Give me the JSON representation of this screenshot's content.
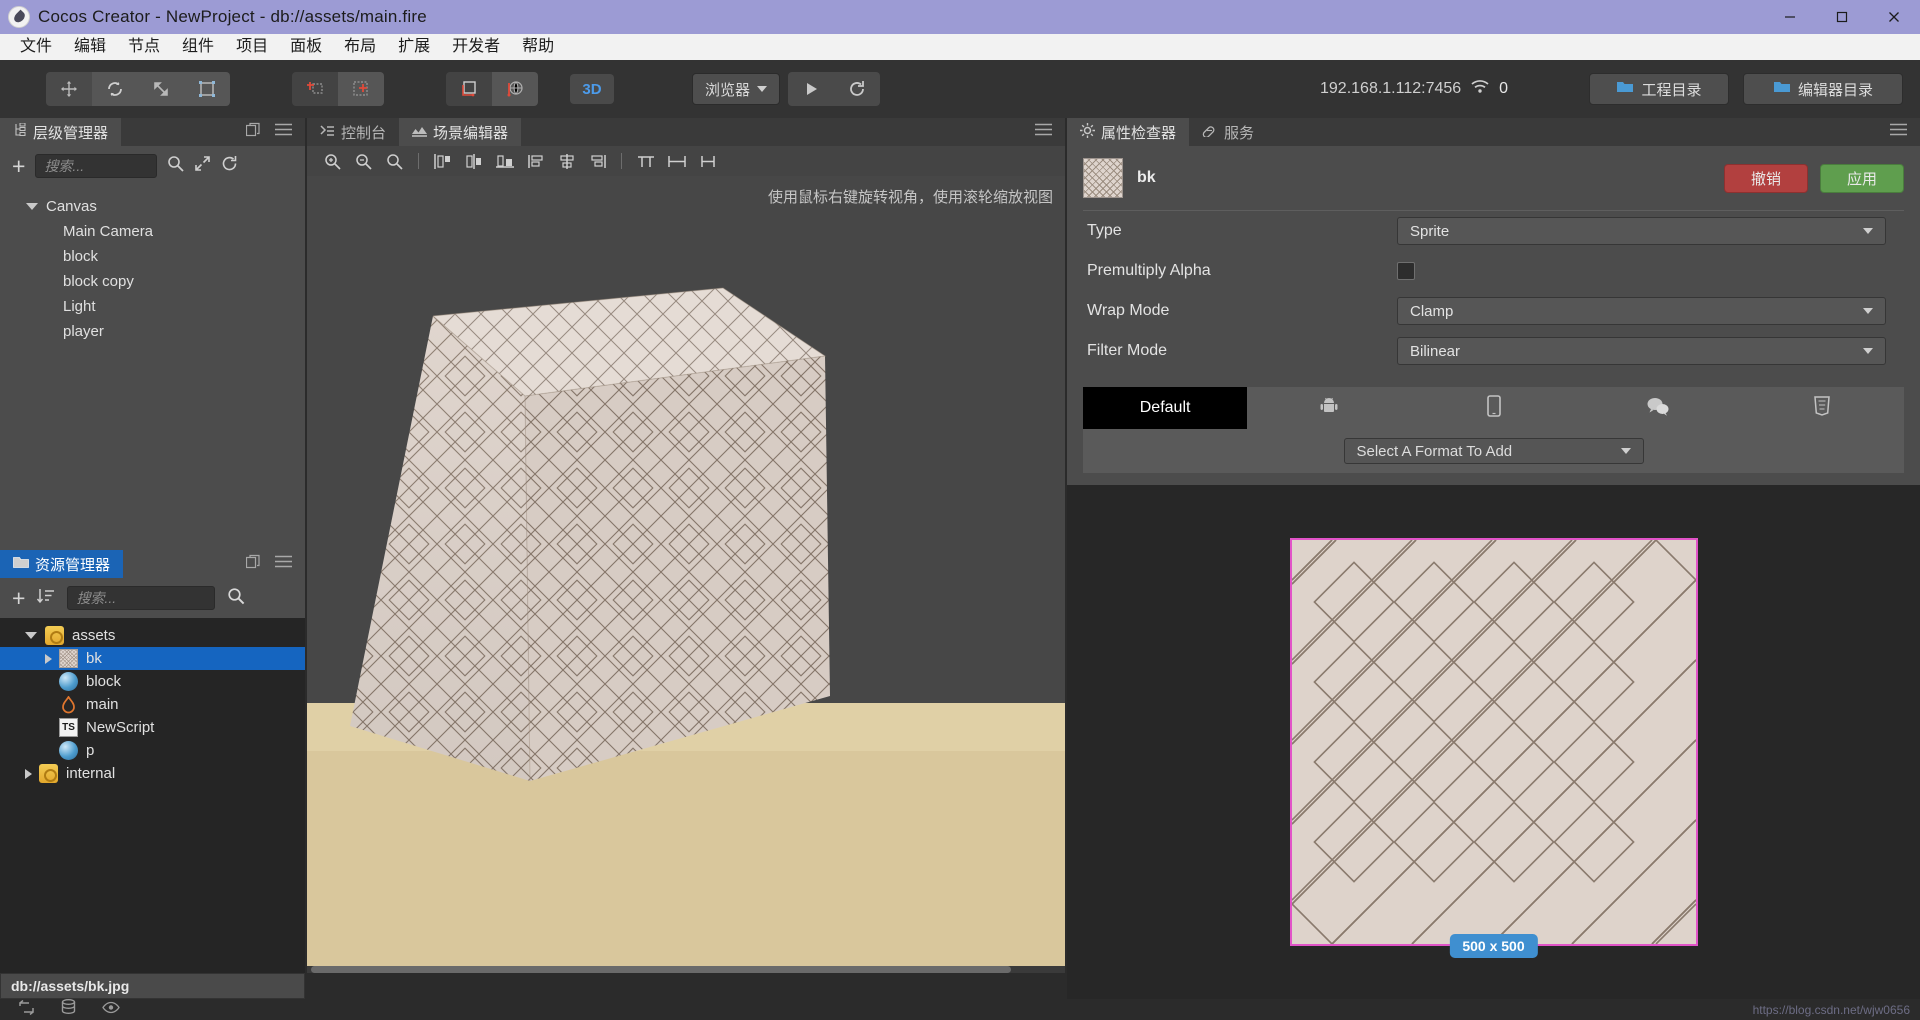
{
  "window": {
    "title": "Cocos Creator - NewProject - db://assets/main.fire",
    "logo_icon": "cocos-logo-icon",
    "minimize_icon": "minimize-icon",
    "maximize_icon": "maximize-icon",
    "close_icon": "close-icon"
  },
  "menubar": {
    "items": [
      {
        "label": "文件"
      },
      {
        "label": "编辑"
      },
      {
        "label": "节点"
      },
      {
        "label": "组件"
      },
      {
        "label": "项目"
      },
      {
        "label": "面板"
      },
      {
        "label": "布局"
      },
      {
        "label": "扩展"
      },
      {
        "label": "开发者"
      },
      {
        "label": "帮助"
      }
    ]
  },
  "toolbar": {
    "transform_tools": [
      {
        "icon": "move-tool-icon",
        "active": false
      },
      {
        "icon": "rotate-tool-icon",
        "active": true
      },
      {
        "icon": "scale-tool-icon",
        "active": false
      },
      {
        "icon": "rect-transform-tool-icon",
        "active": false
      }
    ],
    "pivot_tools": [
      {
        "icon": "pivot-center-icon",
        "active": false
      },
      {
        "icon": "pivot-pivot-icon",
        "active": true
      }
    ],
    "coord_tools": [
      {
        "icon": "local-coord-icon",
        "active": false
      },
      {
        "icon": "global-coord-icon",
        "active": true
      }
    ],
    "view_3d_label": "3D",
    "preview_target": "浏览器",
    "play_icon": "play-icon",
    "refresh_icon": "refresh-icon",
    "ip_address": "192.168.1.112:7456",
    "wifi_icon": "wifi-icon",
    "device_count": "0",
    "project_dir_label": "工程目录",
    "editor_dir_label": "编辑器目录",
    "folder_icon": "folder-icon"
  },
  "hierarchy": {
    "tab_label": "层级管理器",
    "tab_icon": "hierarchy-icon",
    "popout_icon": "popout-icon",
    "menu_icon": "hamburger-menu-icon",
    "add_icon": "plus-icon",
    "search_placeholder": "搜索...",
    "search_value": "",
    "search_icon": "search-icon",
    "expand_icon": "expand-icon",
    "sync_icon": "sync-icon",
    "nodes": [
      {
        "label": "Canvas",
        "depth": 0,
        "expanded": true,
        "has_children": true
      },
      {
        "label": "Main Camera",
        "depth": 1,
        "expanded": false,
        "has_children": false
      },
      {
        "label": "block",
        "depth": 1,
        "expanded": false,
        "has_children": false
      },
      {
        "label": "block copy",
        "depth": 1,
        "expanded": false,
        "has_children": false
      },
      {
        "label": "Light",
        "depth": 1,
        "expanded": false,
        "has_children": false
      },
      {
        "label": "player",
        "depth": 1,
        "expanded": false,
        "has_children": false
      }
    ]
  },
  "assets": {
    "tab_label": "资源管理器",
    "tab_icon": "assets-folder-icon",
    "popout_icon": "popout-icon",
    "menu_icon": "hamburger-menu-icon",
    "add_icon": "plus-icon",
    "sort_icon": "sort-icon",
    "search_placeholder": "搜索...",
    "search_value": "",
    "search_icon": "search-icon",
    "items": [
      {
        "label": "assets",
        "depth": 0,
        "icon": "folder-asset-icon",
        "expanded": true,
        "has_children": true,
        "selected": false
      },
      {
        "label": "bk",
        "depth": 1,
        "icon": "texture-icon",
        "expanded": false,
        "has_children": true,
        "selected": true
      },
      {
        "label": "block",
        "depth": 1,
        "icon": "material-icon",
        "expanded": false,
        "has_children": false,
        "selected": false
      },
      {
        "label": "main",
        "depth": 1,
        "icon": "scene-icon",
        "expanded": false,
        "has_children": false,
        "selected": false
      },
      {
        "label": "NewScript",
        "depth": 1,
        "icon": "typescript-icon",
        "expanded": false,
        "has_children": false,
        "selected": false
      },
      {
        "label": "p",
        "depth": 1,
        "icon": "material-icon",
        "expanded": false,
        "has_children": false,
        "selected": false
      },
      {
        "label": "internal",
        "depth": 0,
        "icon": "folder-asset-icon",
        "expanded": false,
        "has_children": true,
        "selected": false
      }
    ],
    "path_value": "db://assets/bk.jpg"
  },
  "statusbar": {
    "icons": [
      "sync-status-icon",
      "database-icon",
      "eye-icon"
    ],
    "watermark": "https://blog.csdn.net/wjw0656"
  },
  "scene": {
    "tabs": [
      {
        "label": "控制台",
        "icon": "console-icon",
        "active": false
      },
      {
        "label": "场景编辑器",
        "icon": "scene-editor-icon",
        "active": true
      }
    ],
    "menu_icon": "hamburger-menu-icon",
    "toolbar_icons": [
      "zoom-in-icon",
      "zoom-out-icon",
      "zoom-reset-icon",
      "align-left-icon",
      "align-center-h-icon",
      "align-right-icon",
      "align-top-icon",
      "align-middle-v-icon",
      "align-bottom-icon",
      "distribute-h-icon",
      "distribute-v-icon"
    ],
    "hint": "使用鼠标右键旋转视角，使用滚轮缩放视图"
  },
  "inspector": {
    "tabs": [
      {
        "label": "属性检查器",
        "icon": "gear-icon",
        "active": true
      },
      {
        "label": "服务",
        "icon": "services-icon",
        "active": false
      }
    ],
    "menu_icon": "hamburger-menu-icon",
    "asset_name": "bk",
    "thumbnail_icon": "texture-thumbnail",
    "revert_label": "撤销",
    "apply_label": "应用",
    "properties": [
      {
        "label": "Type",
        "type": "select",
        "value": "Sprite"
      },
      {
        "label": "Premultiply Alpha",
        "type": "checkbox",
        "value": false
      },
      {
        "label": "Wrap Mode",
        "type": "select",
        "value": "Clamp"
      },
      {
        "label": "Filter Mode",
        "type": "select",
        "value": "Bilinear"
      }
    ],
    "format_tabs": [
      {
        "label": "Default",
        "icon": "",
        "active": true
      },
      {
        "label": "",
        "icon": "android-icon",
        "active": false
      },
      {
        "label": "",
        "icon": "ios-device-icon",
        "active": false
      },
      {
        "label": "",
        "icon": "wechat-icon",
        "active": false
      },
      {
        "label": "",
        "icon": "html5-icon",
        "active": false
      }
    ],
    "format_select_label": "Select A Format To Add",
    "preview_size_badge": "500 x 500"
  },
  "colors": {
    "titlebar": "#9c9bd4",
    "menubar": "#f2f2f2",
    "toolbar": "#333333",
    "panel": "#4c4c4c",
    "panel_dark": "#252525",
    "selection_blue": "#1565c0",
    "accent_3d": "#4c9bea",
    "revert_red": "#b2403f",
    "apply_green": "#5f9e4e",
    "badge_blue": "#3f8fd0",
    "preview_border": "#e153c8",
    "ground": "#d9c79c"
  }
}
